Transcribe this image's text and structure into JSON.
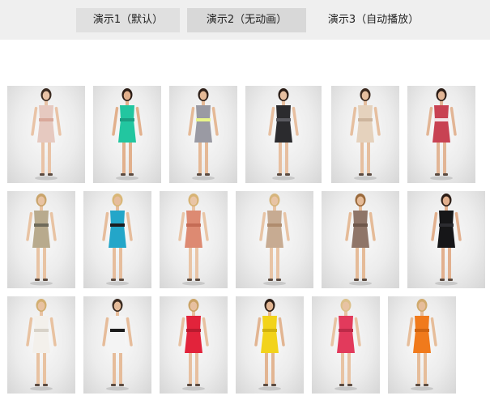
{
  "tabs": [
    {
      "label": "演示1（默认）",
      "selected": false
    },
    {
      "label": "演示2（无动画）",
      "selected": true
    },
    {
      "label": "演示3（自动播放）",
      "selected": false
    }
  ],
  "gallery": {
    "rows": [
      [
        {
          "id": "dress-1",
          "dress": "#e6c9c0",
          "trim": "#d9a89a",
          "skin": "#e9c3a6",
          "hair": "#3a2a20"
        },
        {
          "id": "dress-2",
          "dress": "#22c6a0",
          "trim": "#1a9f82",
          "skin": "#e2b08c",
          "hair": "#2b1d16"
        },
        {
          "id": "dress-3",
          "dress": "#9a9aa3",
          "trim": "#e9f58a",
          "skin": "#e5b996",
          "hair": "#2f2019"
        },
        {
          "id": "dress-4",
          "dress": "#2b2b2e",
          "trim": "#5a5a60",
          "skin": "#e7bfa0",
          "hair": "#2a1c15"
        },
        {
          "id": "dress-5",
          "dress": "#e5d2bd",
          "trim": "#cdb59d",
          "skin": "#e6bf9f",
          "hair": "#3b291e"
        },
        {
          "id": "dress-6",
          "dress": "#c84253",
          "trim": "#f2e4e8",
          "skin": "#e2b595",
          "hair": "#2b1c15"
        }
      ],
      [
        {
          "id": "dress-7",
          "dress": "#b8aa8d",
          "trim": "#6f6a5a",
          "skin": "#e8c3a3",
          "hair": "#c9a46b"
        },
        {
          "id": "dress-8",
          "dress": "#23a6c9",
          "trim": "#1c1c1f",
          "skin": "#e6bd9c",
          "hair": "#d9b777"
        },
        {
          "id": "dress-9",
          "dress": "#dd8a72",
          "trim": "#c56c55",
          "skin": "#e9c5a6",
          "hair": "#d7b374"
        },
        {
          "id": "dress-10",
          "dress": "#c7ab92",
          "trim": "#b08c6e",
          "skin": "#e8c4a5",
          "hair": "#d6b57c"
        },
        {
          "id": "dress-11",
          "dress": "#8f7568",
          "trim": "#6e574b",
          "skin": "#e5bb98",
          "hair": "#9a6a3c"
        },
        {
          "id": "dress-12",
          "dress": "#161618",
          "trim": "#2c2c30",
          "skin": "#e2b08e",
          "hair": "#2b1d16"
        }
      ],
      [
        {
          "id": "dress-13",
          "dress": "#f3f0eb",
          "trim": "#d8d2c8",
          "skin": "#e8c2a1",
          "hair": "#d2ae70"
        },
        {
          "id": "dress-14",
          "dress": "#f4f4f4",
          "trim": "#1c1c1c",
          "skin": "#e6bc9a",
          "hair": "#3a2a20"
        },
        {
          "id": "dress-15",
          "dress": "#e2233b",
          "trim": "#b81a2e",
          "skin": "#e7c0a0",
          "hair": "#caa265"
        },
        {
          "id": "dress-16",
          "dress": "#f2d31b",
          "trim": "#d1b20e",
          "skin": "#e2b592",
          "hair": "#2d1f17"
        },
        {
          "id": "dress-17",
          "dress": "#e23a5c",
          "trim": "#bd2a48",
          "skin": "#e8c3a3",
          "hair": "#dcc08a"
        },
        {
          "id": "dress-18",
          "dress": "#f07a1c",
          "trim": "#cf6411",
          "skin": "#e6bd9a",
          "hair": "#d0aa6d"
        }
      ]
    ]
  }
}
